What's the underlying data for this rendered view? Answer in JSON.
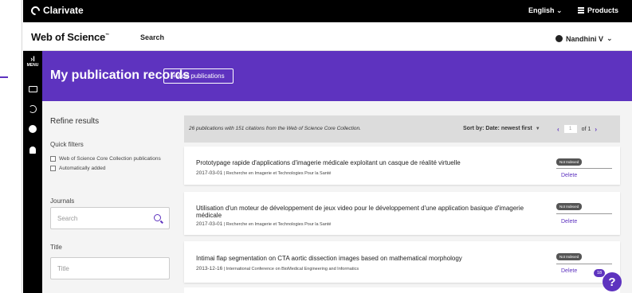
{
  "topbar": {
    "brand": "Clarivate",
    "language": "English",
    "products": "Products"
  },
  "header": {
    "logo": "Web of Science",
    "logo_tm": "™",
    "search_link": "Search",
    "user": "Nandhini V"
  },
  "sidenav": {
    "menu_label": "MENU",
    "menu_chevron": "›I"
  },
  "banner": {
    "title": "My publication records",
    "add_button": "+ Add publications"
  },
  "refine": {
    "title": "Refine results",
    "quick_filters": "Quick filters",
    "filters": [
      "Web of Science Core Collection publications",
      "Automatically added"
    ],
    "journals_label": "Journals",
    "journals_placeholder": "Search",
    "title_label": "Title",
    "title_placeholder": "Title"
  },
  "results": {
    "summary": "26 publications with 151 citations from the Web of Science Core Collection.",
    "sort": "Sort by: Date: newest first",
    "page_current": "1",
    "page_total": "of 1",
    "prev": "‹",
    "next": "›"
  },
  "publications": [
    {
      "title": "Prototypage rapide d'applications d'imagerie médicale exploitant un casque de réalité virtuelle",
      "date": "2017-03-01",
      "source": "Recherche en Imagerie et Technologies Pour la Santé",
      "badge": "Not Indexed",
      "action": "Delete"
    },
    {
      "title": "Utilisation d'un moteur de développement de jeux video pour le développement d'une application basique d'imagerie médicale",
      "date": "2017-03-01",
      "source": "Recherche en Imagerie et Technologies Pour la Santé",
      "badge": "Not Indexed",
      "action": "Delete"
    },
    {
      "title": "Intimai flap segmentation on CTA aortic dissection images based on mathematical morphology",
      "date": "2013-12-16",
      "source": "International Conference on BioMedical Engineering and Informatics",
      "badge": "Not Indexed",
      "action": "Delete"
    }
  ],
  "help": {
    "icon": "?",
    "count": "18"
  },
  "colors": {
    "accent": "#5e33bf",
    "topbar": "#000000",
    "content_bg": "#f4f4f4"
  }
}
